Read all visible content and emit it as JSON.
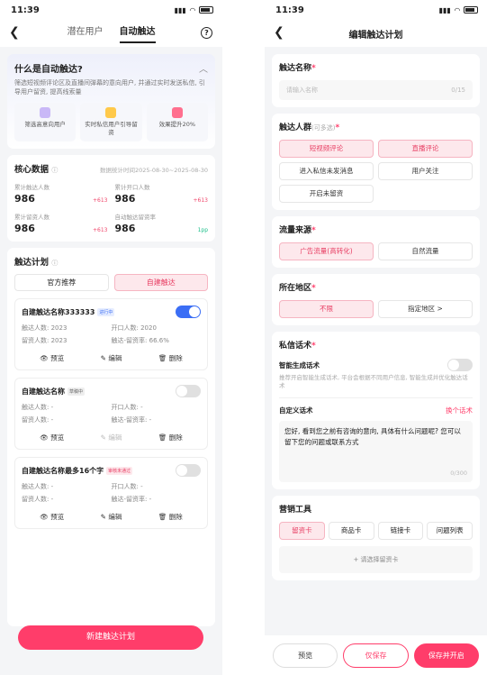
{
  "left": {
    "status_time": "11:39",
    "tabs": [
      "潜在用户",
      "自动触达"
    ],
    "help_icon": "?",
    "intro": {
      "title": "什么是自动触达?",
      "desc": "筛选短视频评论区及直播间弹幕的意向用户, 并通过实时发送私信, 引导用户留资, 提高线索量",
      "steps": [
        "筛选高意向用户",
        "实时私信用户引导留资",
        "效果提升20%"
      ]
    },
    "core": {
      "title": "核心数据",
      "period": "数据统计时间2025-08-30~2025-08-30",
      "stats": [
        {
          "label": "累计触达人数",
          "value": "986",
          "delta": "+613"
        },
        {
          "label": "累计开口人数",
          "value": "986",
          "delta": "+613"
        },
        {
          "label": "累计留资人数",
          "value": "986",
          "delta": "+613"
        },
        {
          "label": "自动触达留资率",
          "value": "986",
          "delta": "1pp"
        }
      ]
    },
    "plans": {
      "title": "触达计划",
      "seg": [
        "官方推荐",
        "自建触达"
      ],
      "items": [
        {
          "name": "自建触达名称333333",
          "badge": "进行中",
          "f1l": "触达人数:",
          "f1v": "2023",
          "f2l": "开口人数:",
          "f2v": "2020",
          "f3l": "留资人数:",
          "f3v": "2023",
          "f4l": "触达-留资率:",
          "f4v": "66.6%"
        },
        {
          "name": "自建触达名称",
          "badge": "草稿中",
          "f1l": "触达人数:",
          "f1v": "-",
          "f2l": "开口人数:",
          "f2v": "-",
          "f3l": "留资人数:",
          "f3v": "-",
          "f4l": "触达-留资率:",
          "f4v": "-"
        },
        {
          "name": "自建触达名称最多16个字",
          "badge": "审核未通过",
          "f1l": "触达人数:",
          "f1v": "-",
          "f2l": "开口人数:",
          "f2v": "-",
          "f3l": "留资人数:",
          "f3v": "-",
          "f4l": "触达-留资率:",
          "f4v": "-"
        }
      ],
      "actions": [
        "预览",
        "编辑",
        "删除"
      ]
    },
    "new_button": "新建触达计划"
  },
  "right": {
    "status_time": "11:39",
    "title": "编辑触达计划",
    "name_label": "触达名称",
    "name_placeholder": "请输入名称",
    "name_count": "0/15",
    "crowd_label": "触达人群",
    "crowd_hint": "(可多选)",
    "crowd_chips": [
      "短视频评论",
      "直播评论",
      "进入私信未发消息",
      "用户关注",
      "开启未留资"
    ],
    "source_label": "流量来源",
    "source_chips": [
      "广告流量(高转化)",
      "自然流量"
    ],
    "region_label": "所在地区",
    "region_chips": [
      "不限",
      "指定地区 >"
    ],
    "dm_label": "私信话术",
    "smart_label": "智能生成话术",
    "smart_desc": "推荐开启智能生成话术, 平台会根据不同用户信息, 智能生成并优化触达话术",
    "custom_label": "自定义话术",
    "change_label": "换个话术",
    "dm_text": "您好, 看到您之前有咨询的意向, 具体有什么问题呢? 您可以留下您的问题或联系方式",
    "dm_count": "0/300",
    "tools_label": "营销工具",
    "tools": [
      "留资卡",
      "商品卡",
      "链接卡",
      "问题列表"
    ],
    "add_card": "+ 请选择留资卡",
    "btn_preview": "预览",
    "btn_save": "仅保存",
    "btn_save_open": "保存并开启"
  }
}
